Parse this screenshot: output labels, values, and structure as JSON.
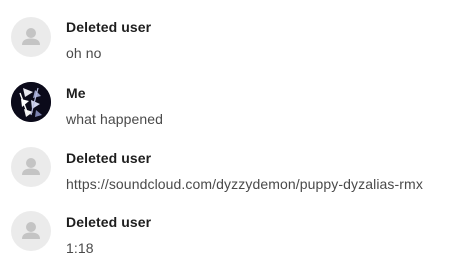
{
  "messages": [
    {
      "author": "Deleted user",
      "text": "oh no",
      "avatar": "default-user-icon"
    },
    {
      "author": "Me",
      "text": "what happened",
      "avatar": "user-profile-picture"
    },
    {
      "author": "Deleted user",
      "text": "https://soundcloud.com/dyzzydemon/puppy-dyzalias-rmx",
      "avatar": "default-user-icon"
    },
    {
      "author": "Deleted user",
      "text": "1:18",
      "avatar": "default-user-icon"
    }
  ],
  "colors": {
    "deleted_avatar_bg": "#ebebeb",
    "deleted_avatar_glyph": "#c4c4c4",
    "me_avatar_bg": "#0b0a1a",
    "author_text": "#1e1e1e",
    "message_text": "#4a4a4a"
  }
}
